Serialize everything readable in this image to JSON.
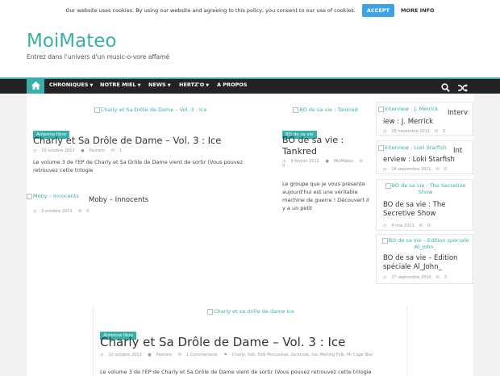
{
  "cookie": {
    "message": "Our website uses cookies. By using our website and agreeing to this policy, you consent to our use of cookies.",
    "accept": "ACCEPT",
    "more": "MORE INFO"
  },
  "site": {
    "title": "MoiMateo",
    "description": "Entrez dans l'univers d'un music-o-vore affamé"
  },
  "nav": {
    "items": [
      "CHRONIQUES",
      "NOTRE MIEL",
      "NEWS",
      "HERTZ'O",
      "A PROPOS"
    ]
  },
  "featured": {
    "img_alt": "Charly et Sa Drôle de Dame – Vol. 3 : Ice",
    "badge": "Antenne libre",
    "title": "Charly et Sa Drôle de Dame – Vol. 3 : Ice",
    "date": "10 octobre 2013",
    "author": "Pashem",
    "comments": "1",
    "excerpt": "Le volume 3 de l'EP de Charly et Sa Drôle de Dame vient de sortir (Vous pouvez retrouvez cette trilogie"
  },
  "moby": {
    "img_alt": "Moby – Innocents",
    "title": "Moby – Innocents",
    "date": "3 octobre 2013",
    "comments": "0"
  },
  "tankred": {
    "img_alt": "BO de sa vie : Tankred",
    "badge": "BO de sa vie",
    "title": "BO de sa vie : Tankred",
    "date": "9 février 2012",
    "author": "MoiMateo",
    "comments": "0",
    "excerpt": "Le groupe que je vous présente aujourd'hui est une véritable machine de guerre ! Découvert il y a un petit"
  },
  "sidebar": [
    {
      "img_alt": "Interview : J. Merrick",
      "title_a": "Interv",
      "title_b": "iew : J. Merrick",
      "date": "15 novembre 2011",
      "comments": "0"
    },
    {
      "img_alt": "Interview : Loki Starfish",
      "title_a": "Int",
      "title_b": "erview : Loki Starfish",
      "date": "14 septembre 2011",
      "comments": "0"
    },
    {
      "img_alt": "BO de sa vie : The Secretive Show",
      "title": "BO de sa vie : The Secretive Show",
      "date": "4 mai 2011",
      "comments": "0"
    },
    {
      "img_alt": "BO de sa vie – Edition spéciale Al_John_",
      "title": "BO de sa vie – Edition spéciale Al_John_",
      "date": "27 septembre 2010",
      "comments": "3"
    }
  ],
  "post": {
    "img_alt": "Charly et sa drôle de dame Ice",
    "badge": "Antenne libre",
    "title": "Charly et Sa Drôle de Dame – Vol. 3 : Ice",
    "date": "10 octobre 2013",
    "author": "Pashem",
    "comments": "1 Commentaire",
    "tags": "Charly, folk, Folk Percussive, Gertrude, Ice, Melting Folk, Mr Cigar Box",
    "excerpt": "Le volume 3 de l'EP de Charly et Sa Drôle de Dame vient de sortir (Vous pouvez retrouvez cette trilogie"
  },
  "colors": {
    "accent": "#3aafa9",
    "nav_bg": "#232323",
    "cookie_btn": "#3ea2e6"
  }
}
